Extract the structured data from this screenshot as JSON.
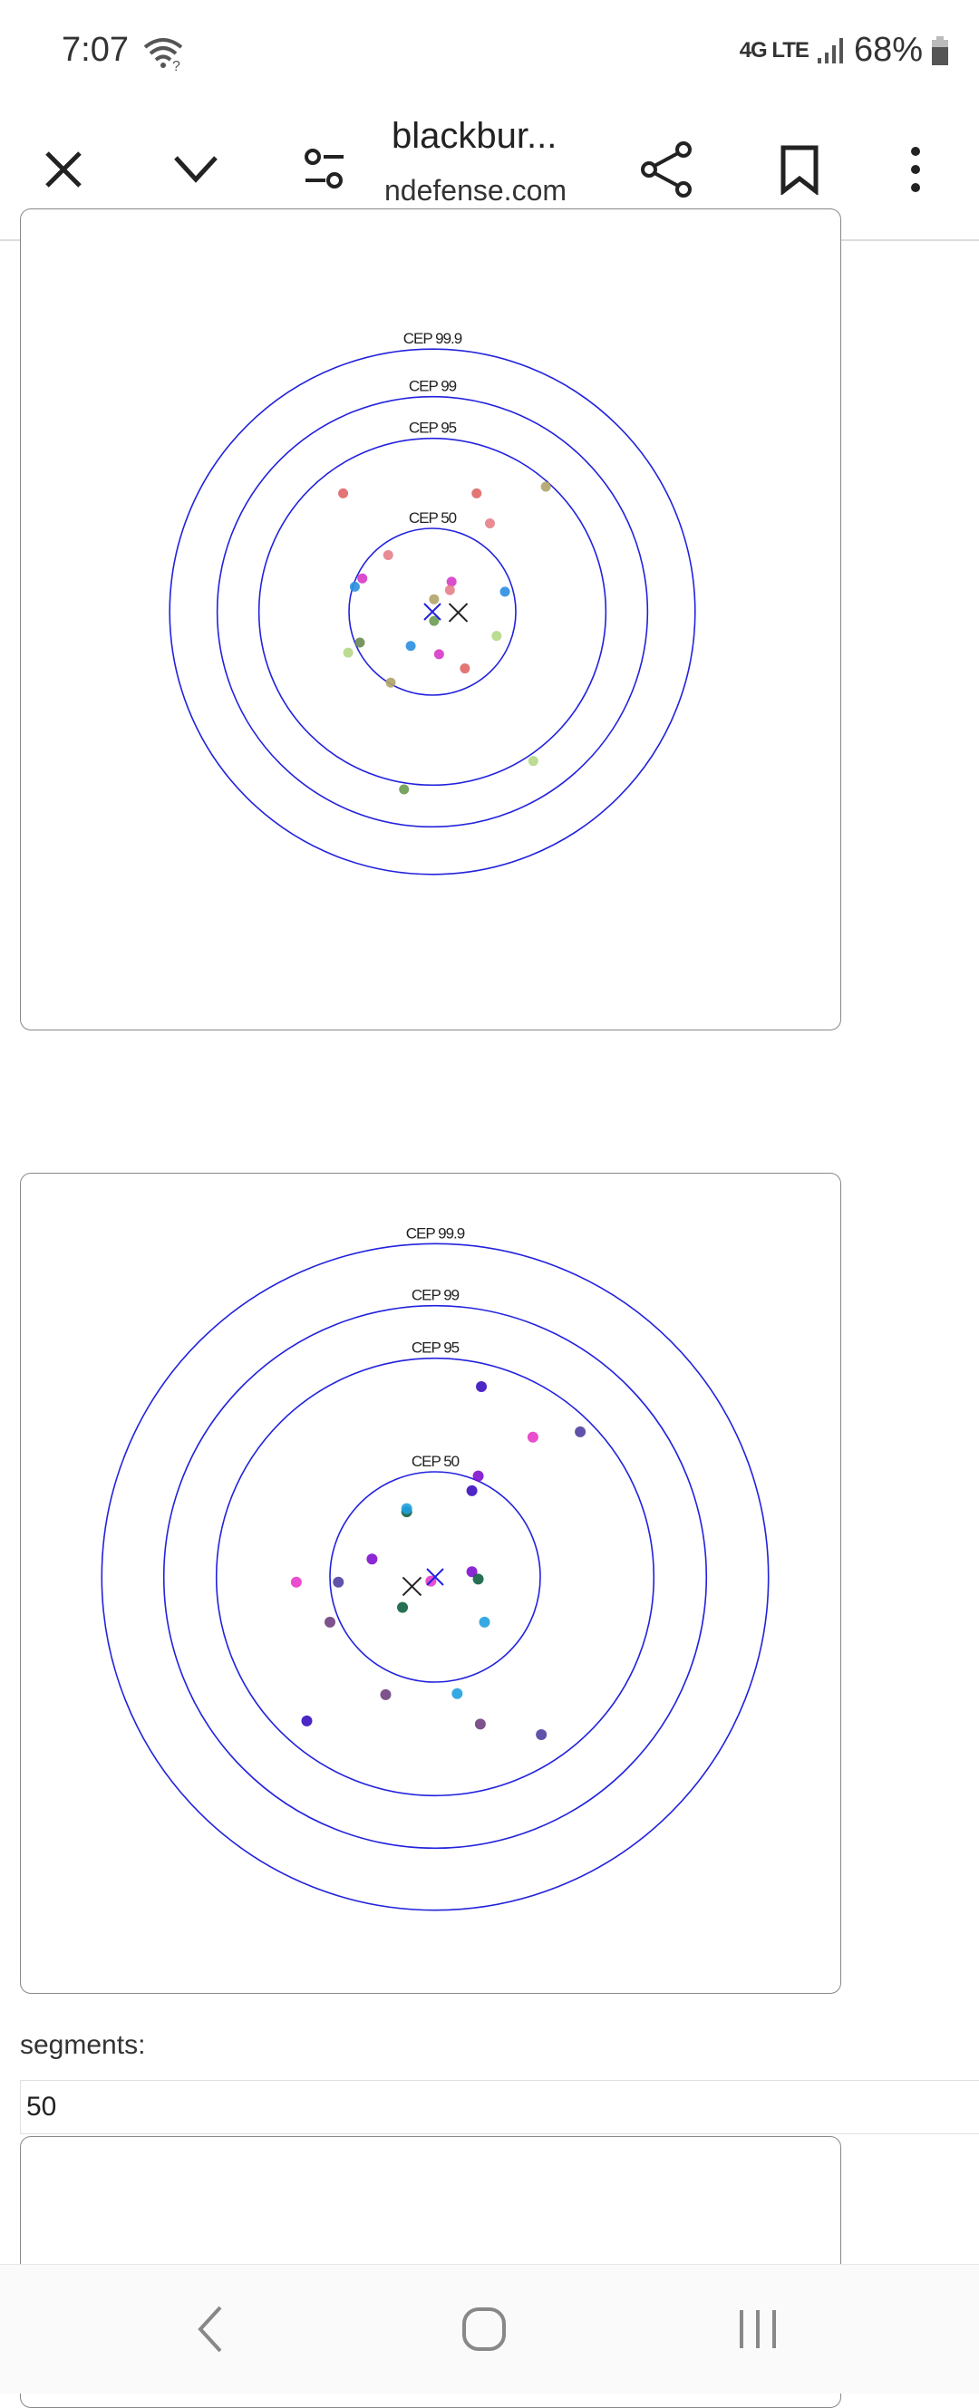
{
  "status_bar": {
    "time": "7:07",
    "network": "4G LTE",
    "battery": "68%"
  },
  "toolbar": {
    "title": "blackbur...",
    "url": "ndefense.com",
    "icons": [
      "close-icon",
      "chevron-down-icon",
      "site-settings-icon",
      "share-icon",
      "bookmark-icon",
      "more-vert-icon"
    ]
  },
  "chart_data": [
    {
      "type": "scatter",
      "rings": [
        {
          "label": "CEP 50",
          "radius": 1.0
        },
        {
          "label": "CEP 95",
          "radius": 2.08
        },
        {
          "label": "CEP 99",
          "radius": 2.58
        },
        {
          "label": "CEP 99.9",
          "radius": 3.15
        }
      ],
      "ring_color": "#2222dd",
      "aim_point": {
        "x": 0,
        "y": 0,
        "color": "#2222dd"
      },
      "mean_point": {
        "x": 0.31,
        "y": -0.01,
        "color": "#222222"
      },
      "points": [
        {
          "x": -1.07,
          "y": 1.42,
          "color": "#e06666"
        },
        {
          "x": 0.53,
          "y": 1.42,
          "color": "#e06666"
        },
        {
          "x": 1.36,
          "y": 1.5,
          "color": "#b0a468"
        },
        {
          "x": 0.69,
          "y": 1.06,
          "color": "#e57f8a"
        },
        {
          "x": -0.53,
          "y": 0.68,
          "color": "#e57f8a"
        },
        {
          "x": -0.84,
          "y": 0.4,
          "color": "#d63ac8"
        },
        {
          "x": -0.93,
          "y": 0.3,
          "color": "#2a8fe0"
        },
        {
          "x": 0.23,
          "y": 0.36,
          "color": "#d63ac8"
        },
        {
          "x": 0.21,
          "y": 0.26,
          "color": "#e57f8a"
        },
        {
          "x": 0.87,
          "y": 0.24,
          "color": "#2a8fe0"
        },
        {
          "x": 0.02,
          "y": 0.15,
          "color": "#b0a468"
        },
        {
          "x": 0.02,
          "y": -0.11,
          "color": "#6a9a50"
        },
        {
          "x": 0.77,
          "y": -0.29,
          "color": "#b4d886"
        },
        {
          "x": -0.87,
          "y": -0.37,
          "color": "#6a8a50"
        },
        {
          "x": -1.01,
          "y": -0.49,
          "color": "#b4d886"
        },
        {
          "x": -0.26,
          "y": -0.41,
          "color": "#2a8fe0"
        },
        {
          "x": 0.08,
          "y": -0.51,
          "color": "#d63ac8"
        },
        {
          "x": 0.39,
          "y": -0.68,
          "color": "#e06666"
        },
        {
          "x": -0.5,
          "y": -0.85,
          "color": "#b0a468"
        },
        {
          "x": 1.21,
          "y": -1.79,
          "color": "#b4d886"
        },
        {
          "x": -0.34,
          "y": -2.13,
          "color": "#6a9a50"
        }
      ]
    },
    {
      "type": "scatter",
      "rings": [
        {
          "label": "CEP 50",
          "radius": 1.0
        },
        {
          "label": "CEP 95",
          "radius": 2.08
        },
        {
          "label": "CEP 99",
          "radius": 2.58
        },
        {
          "label": "CEP 99.9",
          "radius": 3.17
        }
      ],
      "ring_color": "#2222dd",
      "aim_point": {
        "x": 0,
        "y": 0,
        "color": "#2222dd"
      },
      "mean_point": {
        "x": -0.22,
        "y": -0.09,
        "color": "#222222"
      },
      "points": [
        {
          "x": 0.44,
          "y": 1.81,
          "color": "#3a10c0"
        },
        {
          "x": 0.93,
          "y": 1.33,
          "color": "#e83ac8"
        },
        {
          "x": 1.38,
          "y": 1.38,
          "color": "#5040a0"
        },
        {
          "x": 0.41,
          "y": 0.96,
          "color": "#8010d0"
        },
        {
          "x": 0.35,
          "y": 0.82,
          "color": "#3a10c0"
        },
        {
          "x": -0.27,
          "y": 0.62,
          "color": "#106040"
        },
        {
          "x": -0.27,
          "y": 0.65,
          "color": "#20a0e0"
        },
        {
          "x": -0.6,
          "y": 0.17,
          "color": "#8010d0"
        },
        {
          "x": 0.35,
          "y": 0.05,
          "color": "#8010d0"
        },
        {
          "x": 0.41,
          "y": -0.02,
          "color": "#106040"
        },
        {
          "x": -1.32,
          "y": -0.05,
          "color": "#e83ac8"
        },
        {
          "x": -0.92,
          "y": -0.05,
          "color": "#5040a0"
        },
        {
          "x": -0.04,
          "y": -0.04,
          "color": "#e83ac8"
        },
        {
          "x": -0.31,
          "y": -0.29,
          "color": "#106040"
        },
        {
          "x": 0.47,
          "y": -0.43,
          "color": "#20a0e0"
        },
        {
          "x": -1.0,
          "y": -0.43,
          "color": "#704080"
        },
        {
          "x": -0.47,
          "y": -1.12,
          "color": "#704080"
        },
        {
          "x": 0.21,
          "y": -1.11,
          "color": "#20a0e0"
        },
        {
          "x": -1.22,
          "y": -1.37,
          "color": "#3a10c0"
        },
        {
          "x": 0.43,
          "y": -1.4,
          "color": "#704080"
        },
        {
          "x": 1.01,
          "y": -1.5,
          "color": "#5040a0"
        }
      ]
    }
  ],
  "segments": {
    "label": "segments:",
    "value": "50"
  },
  "nav": {
    "icons": [
      "back-icon",
      "home-icon",
      "recents-icon"
    ]
  }
}
